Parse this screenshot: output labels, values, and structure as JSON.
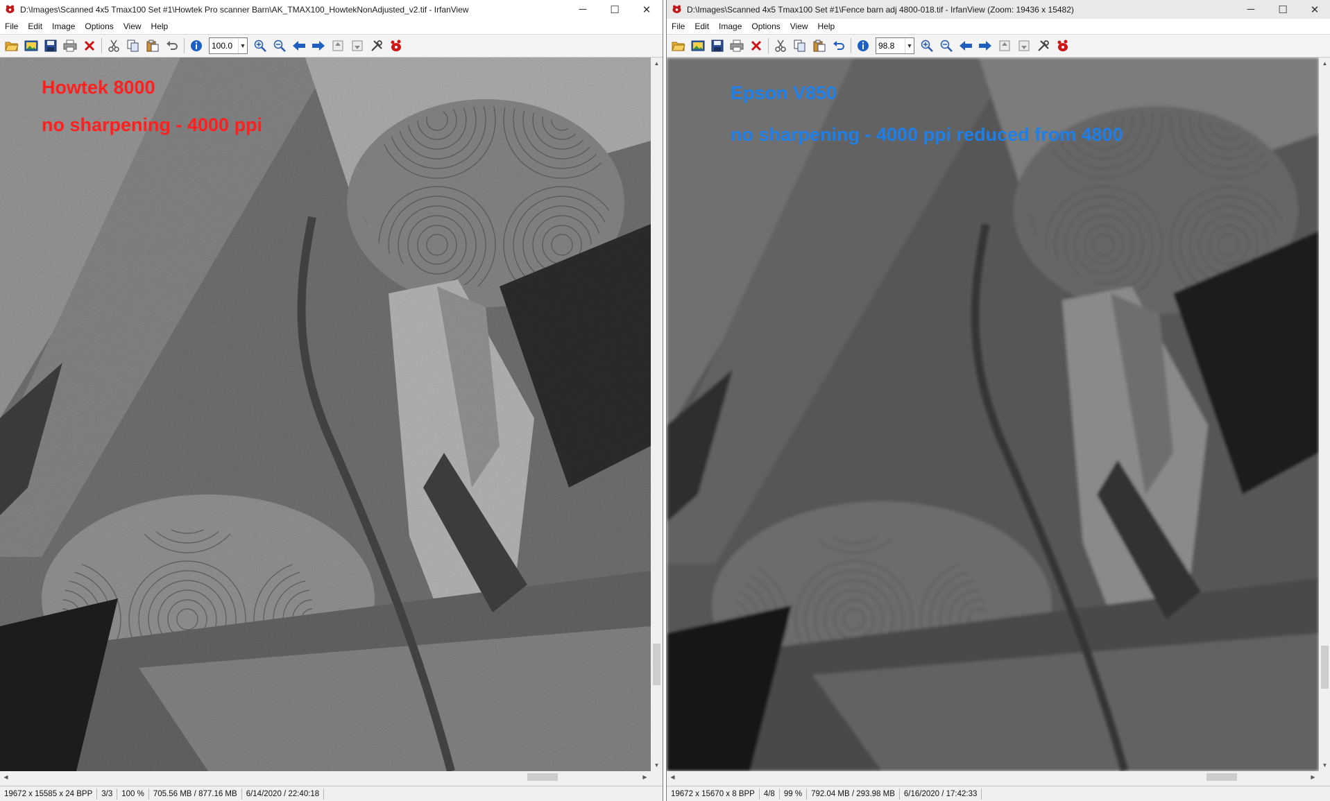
{
  "left": {
    "title": "D:\\Images\\Scanned 4x5 Tmax100 Set #1\\Howtek Pro scanner Barn\\AK_TMAX100_HowtekNonAdjusted_v2.tif - IrfanView",
    "menu": [
      "File",
      "Edit",
      "Image",
      "Options",
      "View",
      "Help"
    ],
    "zoom": "100.0",
    "labels": {
      "line1": "Howtek 8000",
      "line2": "no sharpening - 4000 ppi",
      "color": "#ff1f1f"
    },
    "status": [
      "19672 x 15585 x 24 BPP",
      "3/3",
      "100 %",
      "705.56 MB / 877.16 MB",
      "6/14/2020 / 22:40:18"
    ]
  },
  "right": {
    "title": "D:\\Images\\Scanned 4x5 Tmax100 Set #1\\Fence barn adj 4800-018.tif - IrfanView (Zoom: 19436 x 15482)",
    "menu": [
      "File",
      "Edit",
      "Image",
      "Options",
      "View",
      "Help"
    ],
    "zoom": "98.8",
    "labels": {
      "line1": "Epson V850",
      "line2": "no sharpening - 4000 ppi reduced from 4800",
      "color": "#1e7fe8"
    },
    "status": [
      "19672 x 15670 x 8 BPP",
      "4/8",
      "99 %",
      "792.04 MB / 293.98 MB",
      "6/16/2020 / 17:42:33"
    ]
  },
  "window_controls": [
    "─",
    "☐",
    "✕"
  ],
  "toolbar_icons": [
    "open-icon",
    "thumbnails-icon",
    "save-icon",
    "print-icon",
    "delete-icon",
    "cut-icon",
    "copy-icon",
    "paste-icon",
    "undo-icon",
    "info-icon",
    "zoom-in-icon",
    "zoom-out-icon",
    "previous-icon",
    "next-icon",
    "first-page-icon",
    "last-page-icon",
    "settings-icon",
    "irfanview-logo-icon"
  ]
}
